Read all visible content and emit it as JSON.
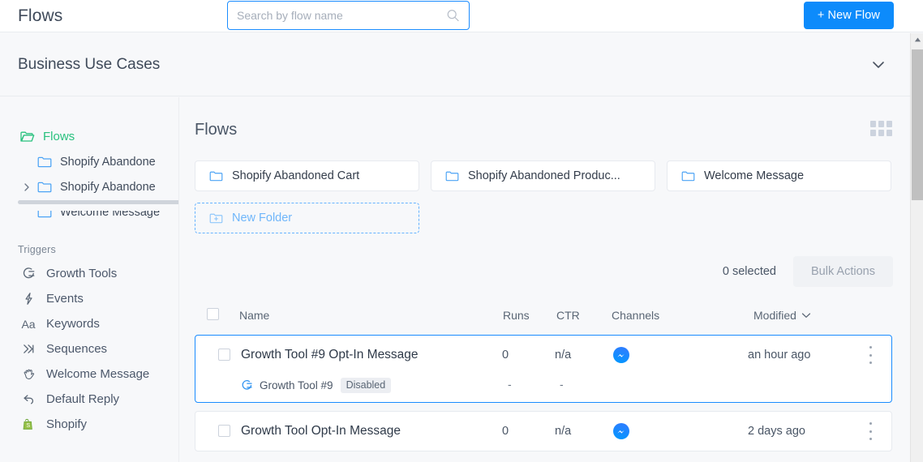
{
  "topbar": {
    "title": "Flows",
    "search": {
      "value": "",
      "placeholder": "Search by flow name",
      "icon": "search-icon"
    },
    "new_flow_label": "+ New Flow",
    "accent_color": "#0d8bfb"
  },
  "section": {
    "title": "Business Use Cases",
    "chevron_icon": "chevron-down-icon"
  },
  "sidebar": {
    "tree": [
      {
        "label": "Flows",
        "icon": "folder-open-icon",
        "level": 0,
        "active": true,
        "caret": false
      },
      {
        "label": "Shopify Abandone",
        "icon": "folder-icon",
        "level": 1,
        "active": false,
        "caret": false
      },
      {
        "label": "Shopify Abandone",
        "icon": "folder-icon",
        "level": 1,
        "active": false,
        "caret": true
      },
      {
        "label": "Welcome Message",
        "icon": "folder-icon",
        "level": 1,
        "active": false,
        "caret": false
      }
    ],
    "group_label": "Triggers",
    "items": [
      {
        "label": "Growth Tools",
        "icon": "growth-tool-icon"
      },
      {
        "label": "Events",
        "icon": "lightning-icon"
      },
      {
        "label": "Keywords",
        "icon": "keywords-aa-icon"
      },
      {
        "label": "Sequences",
        "icon": "sequences-icon"
      },
      {
        "label": "Welcome Message",
        "icon": "wave-hand-icon"
      },
      {
        "label": "Default Reply",
        "icon": "reply-arrow-icon"
      },
      {
        "label": "Shopify",
        "icon": "shopify-bag-icon"
      }
    ],
    "active_color": "#29c17e"
  },
  "main": {
    "heading": "Flows",
    "grid_toggle_icon": "grid-view-icon",
    "folders": [
      {
        "label": "Shopify Abandoned Cart",
        "icon": "folder-icon",
        "is_new": false
      },
      {
        "label": "Shopify Abandoned Produc...",
        "icon": "folder-icon",
        "is_new": false
      },
      {
        "label": "Welcome Message",
        "icon": "folder-icon",
        "is_new": false
      },
      {
        "label": "New Folder",
        "icon": "folder-plus-icon",
        "is_new": true
      }
    ],
    "bulk": {
      "selected_text": "0 selected",
      "bulk_actions_label": "Bulk Actions"
    },
    "table": {
      "columns": {
        "name": "Name",
        "runs": "Runs",
        "ctr": "CTR",
        "channels": "Channels",
        "modified": "Modified"
      },
      "sort_icon": "chevron-down-icon",
      "rows": [
        {
          "name": "Growth Tool #9 Opt-In Message",
          "runs": "0",
          "ctr": "n/a",
          "channel_icon": "messenger-icon",
          "modified": "an hour ago",
          "selected": false,
          "highlighted": true,
          "menu_icon": "kebab-menu-icon",
          "sub": {
            "trigger_icon": "growth-tool-icon",
            "trigger_label": "Growth Tool #9",
            "status_badge": "Disabled",
            "runs": "-",
            "ctr": "-"
          }
        },
        {
          "name": "Growth Tool Opt-In Message",
          "runs": "0",
          "ctr": "n/a",
          "channel_icon": "messenger-icon",
          "modified": "2 days ago",
          "selected": false,
          "highlighted": false,
          "menu_icon": "kebab-menu-icon",
          "sub": null
        }
      ]
    }
  },
  "scrollbar": {
    "up_arrow_icon": "scroll-up-arrow-icon",
    "thumb_name": "vertical-scroll-thumb"
  }
}
